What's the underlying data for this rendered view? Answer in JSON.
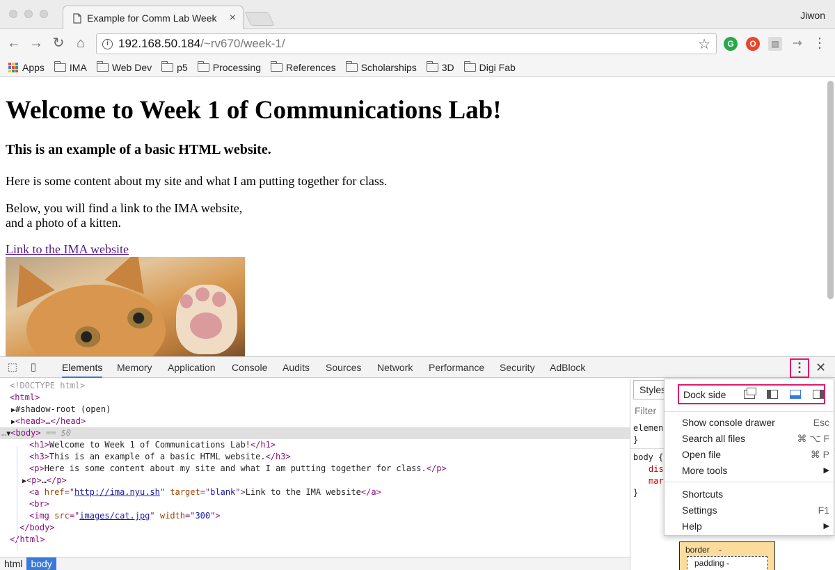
{
  "browser": {
    "tab_title": "Example for Comm Lab Week",
    "profile_name": "Jiwon",
    "url_host": "192.168.50.184",
    "url_path": "/~rv670/week-1/"
  },
  "bookmarks": {
    "apps_label": "Apps",
    "folders": [
      "IMA",
      "Web Dev",
      "p5",
      "Processing",
      "References",
      "Scholarships",
      "3D",
      "Digi Fab"
    ]
  },
  "page": {
    "h1": "Welcome to Week 1 of Communications Lab!",
    "h3": "This is an example of a basic HTML website.",
    "p1": "Here is some content about my site and what I am putting together for class.",
    "p2_line1": "Below, you will find a link to the IMA website,",
    "p2_line2": "and a photo of a kitten.",
    "link_text": "Link to the IMA website"
  },
  "devtools": {
    "tabs": [
      "Elements",
      "Memory",
      "Application",
      "Console",
      "Audits",
      "Sources",
      "Network",
      "Performance",
      "Security",
      "AdBlock"
    ],
    "active_tab": "Elements",
    "dom": {
      "doctype": "<!DOCTYPE html>",
      "html_open": "<html>",
      "shadow_root": "#shadow-root (open)",
      "head": "<head>…</head>",
      "body_open": "<body>",
      "body_marker": " == $0",
      "h1_text": "Welcome to Week 1 of Communications Lab!",
      "h3_text": "This is an example of a basic HTML website.",
      "p_text": "Here is some content about my site and what I am putting together for class.",
      "p_collapsed": "…",
      "a_href": "http://ima.nyu.sh",
      "a_target": "blank",
      "a_text": "Link to the IMA website",
      "img_src": "images/cat.jpg",
      "img_width": "300"
    },
    "breadcrumbs": [
      "html",
      "body"
    ],
    "styles": {
      "tab_label": "Styles",
      "filter_placeholder": "Filter",
      "element_rule": "elemen",
      "close_brace": "}",
      "body_selector": "body {",
      "prop1": "dis",
      "prop2": "mar",
      "box_border": "border",
      "box_border_value": "-",
      "box_padding": "padding -"
    },
    "menu": {
      "dock_label": "Dock side",
      "items": [
        {
          "label": "Show console drawer",
          "shortcut": "Esc"
        },
        {
          "label": "Search all files",
          "shortcut": "⌘ ⌥ F"
        },
        {
          "label": "Open file",
          "shortcut": "⌘ P"
        },
        {
          "label": "More tools",
          "shortcut": "▶"
        },
        {
          "label": "Shortcuts",
          "shortcut": ""
        },
        {
          "label": "Settings",
          "shortcut": "F1"
        },
        {
          "label": "Help",
          "shortcut": "▶"
        }
      ]
    }
  },
  "colors": {
    "highlight": "#e0196b",
    "devtools_accent": "#3879d9",
    "visited_link": "#551a8b"
  }
}
